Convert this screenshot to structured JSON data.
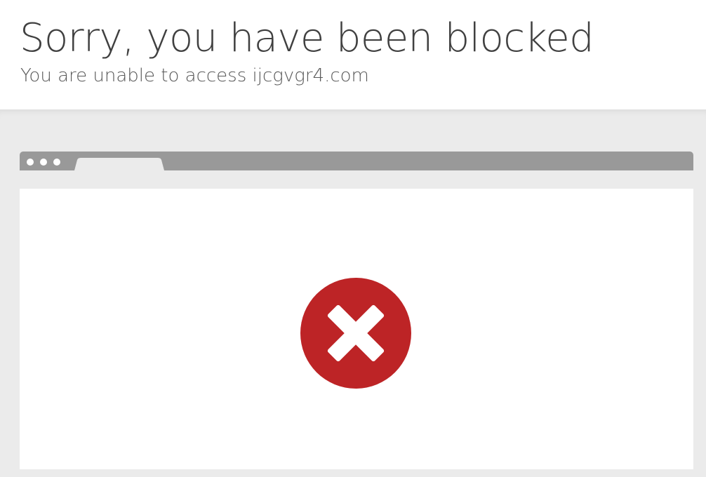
{
  "header": {
    "title": "Sorry, you have been blocked",
    "subtitle": "You are unable to access ijcgvgr4.com"
  },
  "illustration": {
    "window_dots": 3,
    "status_icon": "blocked-x-icon",
    "colors": {
      "page_background": "#ffffff",
      "stage_background": "#ebebeb",
      "browser_bar": "#999999",
      "error_red": "#bd2426",
      "title_text": "#404040"
    }
  }
}
